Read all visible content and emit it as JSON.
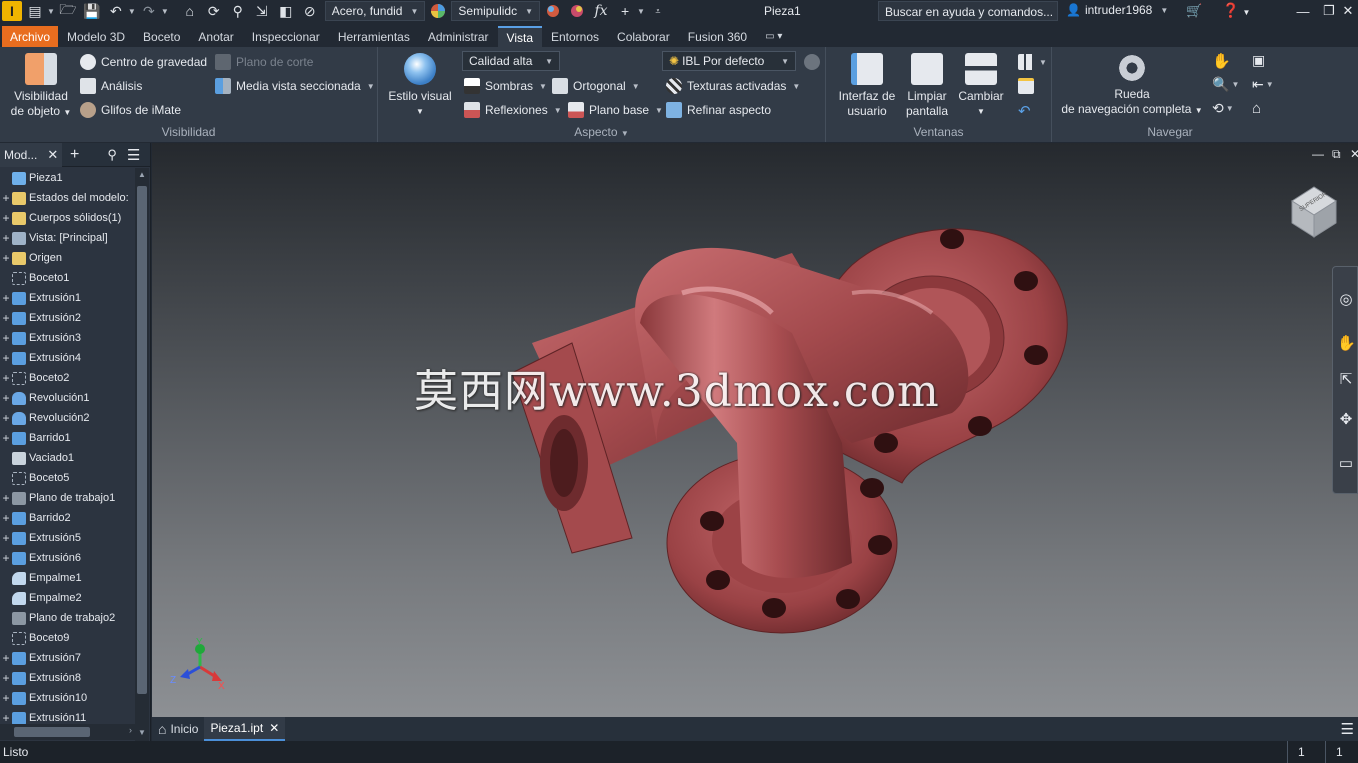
{
  "app": {
    "logo_letter": "I",
    "title": "Pieza1"
  },
  "quick_access": {
    "material": "Acero, fundid",
    "appearance": "Semipulidc",
    "fx": "fx"
  },
  "help_search": {
    "placeholder": "Buscar en ayuda y comandos..."
  },
  "user": {
    "name": "intruder1968"
  },
  "ribbon_tabs": [
    {
      "label": "Archivo"
    },
    {
      "label": "Modelo 3D"
    },
    {
      "label": "Boceto"
    },
    {
      "label": "Anotar"
    },
    {
      "label": "Inspeccionar"
    },
    {
      "label": "Herramientas"
    },
    {
      "label": "Administrar"
    },
    {
      "label": "Vista"
    },
    {
      "label": "Entornos"
    },
    {
      "label": "Colaborar"
    },
    {
      "label": "Fusion 360"
    }
  ],
  "ribbon": {
    "visibilidad": {
      "title": "Visibilidad",
      "big_label_1": "Visibilidad",
      "big_label_2": "de objeto",
      "centro_gravedad": "Centro de gravedad",
      "analisis": "Análisis",
      "glifos": "Glifos de iMate",
      "plano_corte": "Plano de corte",
      "media_vista": "Media vista seccionada"
    },
    "aspecto": {
      "title": "Aspecto",
      "estilo_visual": "Estilo visual",
      "calidad": "Calidad alta",
      "sombras": "Sombras",
      "reflexiones": "Reflexiones",
      "ortogonal": "Ortogonal",
      "plano_base": "Plano base",
      "ibl": "IBL Por defecto",
      "texturas": "Texturas activadas",
      "refinar": "Refinar aspecto"
    },
    "ventanas": {
      "title": "Ventanas",
      "interfaz_1": "Interfaz de",
      "interfaz_2": "usuario",
      "limpiar_1": "Limpiar",
      "limpiar_2": "pantalla",
      "cambiar": "Cambiar"
    },
    "navegar": {
      "title": "Navegar",
      "rueda_1": "Rueda",
      "rueda_2": "de navegación completa"
    }
  },
  "browser": {
    "tab_label": "Mod...",
    "tree": [
      {
        "label": "Pieza1",
        "icon": "part",
        "expander": ""
      },
      {
        "label": "Estados del modelo:",
        "icon": "folder",
        "expander": "+"
      },
      {
        "label": "Cuerpos sólidos(1)",
        "icon": "folder",
        "expander": "+"
      },
      {
        "label": "Vista: [Principal]",
        "icon": "view",
        "expander": "+"
      },
      {
        "label": "Origen",
        "icon": "folder",
        "expander": "+"
      },
      {
        "label": "Boceto1",
        "icon": "sketch",
        "expander": ""
      },
      {
        "label": "Extrusión1",
        "icon": "feat",
        "expander": "+"
      },
      {
        "label": "Extrusión2",
        "icon": "feat",
        "expander": "+"
      },
      {
        "label": "Extrusión3",
        "icon": "feat",
        "expander": "+"
      },
      {
        "label": "Extrusión4",
        "icon": "feat",
        "expander": "+"
      },
      {
        "label": "Boceto2",
        "icon": "sketch",
        "expander": "+"
      },
      {
        "label": "Revolución1",
        "icon": "rev",
        "expander": "+"
      },
      {
        "label": "Revolución2",
        "icon": "rev",
        "expander": "+"
      },
      {
        "label": "Barrido1",
        "icon": "feat",
        "expander": "+"
      },
      {
        "label": "Vaciado1",
        "icon": "shell",
        "expander": ""
      },
      {
        "label": "Boceto5",
        "icon": "sketch",
        "expander": ""
      },
      {
        "label": "Plano de trabajo1",
        "icon": "plane",
        "expander": "+"
      },
      {
        "label": "Barrido2",
        "icon": "feat",
        "expander": "+"
      },
      {
        "label": "Extrusión5",
        "icon": "feat",
        "expander": "+"
      },
      {
        "label": "Extrusión6",
        "icon": "feat",
        "expander": "+"
      },
      {
        "label": "Empalme1",
        "icon": "fillet",
        "expander": ""
      },
      {
        "label": "Empalme2",
        "icon": "fillet",
        "expander": ""
      },
      {
        "label": "Plano de trabajo2",
        "icon": "plane",
        "expander": ""
      },
      {
        "label": "Boceto9",
        "icon": "sketch",
        "expander": ""
      },
      {
        "label": "Extrusión7",
        "icon": "feat",
        "expander": "+"
      },
      {
        "label": "Extrusión8",
        "icon": "feat",
        "expander": "+"
      },
      {
        "label": "Extrusión10",
        "icon": "feat",
        "expander": "+"
      },
      {
        "label": "Extrusión11",
        "icon": "feat",
        "expander": "+"
      }
    ]
  },
  "viewport": {
    "watermark": "莫西网www.3dmox.com",
    "axis_labels": {
      "x": "X",
      "y": "Y",
      "z": "Z"
    },
    "viewcube_label": "SUPERIOR"
  },
  "doc_tabs": {
    "home": "Inicio",
    "active": "Pieza1.ipt"
  },
  "status": {
    "text": "Listo",
    "cell1": "1",
    "cell2": "1"
  },
  "colors": {
    "accent": "#e86d1f",
    "part": "#a5474a",
    "active_tab_line": "#5aa0e6"
  }
}
